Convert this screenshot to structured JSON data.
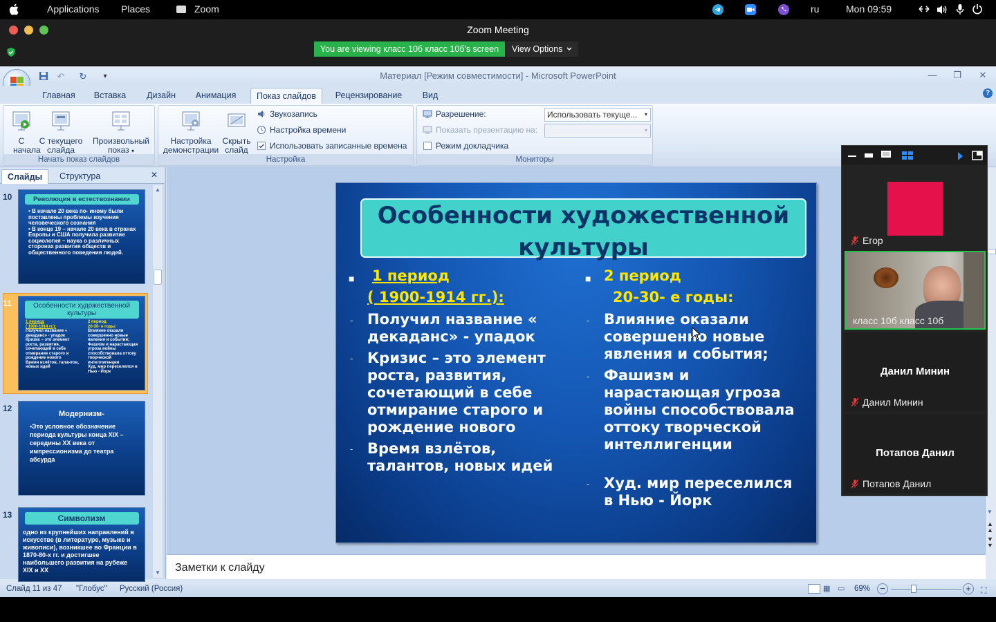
{
  "os_bar": {
    "applications": "Applications",
    "places": "Places",
    "zoom_app": "Zoom",
    "lang": "ru",
    "clock": "Mon 09:59"
  },
  "zoom": {
    "window_title": "Zoom Meeting",
    "viewing_banner": "You are viewing класс 10б класс 10б's screen",
    "view_options": "View Options"
  },
  "ppt": {
    "window_title": "Материал [Режим совместимости] - Microsoft PowerPoint",
    "tabs": [
      "Главная",
      "Вставка",
      "Дизайн",
      "Анимация",
      "Показ слайдов",
      "Рецензирование",
      "Вид"
    ],
    "ribbon": {
      "from_start": "С начала",
      "from_current_l1": "С текущего",
      "from_current_l2": "слайда",
      "custom_l1": "Произвольный",
      "custom_l2": "показ",
      "group1_label": "Начать показ слайдов",
      "setup_l1": "Настройка",
      "setup_l2": "демонстрации",
      "hide_l1": "Скрыть",
      "hide_l2": "слайд",
      "record": "Звукозапись",
      "rehearse": "Настройка времени",
      "use_timings": "Использовать записанные времена",
      "group2_label": "Настройка",
      "resolution_label": "Разрешение:",
      "resolution_value": "Использовать текуще...",
      "show_on_label": "Показать презентацию на:",
      "presenter_view": "Режим докладчика",
      "group3_label": "Мониторы"
    },
    "panel": {
      "tab_slides": "Слайды",
      "tab_outline": "Структура",
      "thumbs": [
        {
          "num": "10",
          "title": "Революция в естествознании",
          "text": "• В начале 20 века по- иному были поставлены проблемы изучения человеческого сознания\n• В конце 19 – начале 20 века в странах Европы и США получила развитие социология – наука о различных сторонах развития обществ и общественного поведения людей."
        },
        {
          "num": "11",
          "title": "Особенности художественной культуры",
          "text": ""
        },
        {
          "num": "12",
          "title": "Модернизм-",
          "text": "•Это условное обозначение периода культуры конца XIX – середины XX века от импрессионизма до театра абсурда"
        },
        {
          "num": "13",
          "title": "Символизм",
          "text": "одно из крупнейших направлений в искусстве (в литературе, музыке и живописи), возникшее во Франции в 1870-80-х гг. и достигшее наибольшего развития на рубеже XIX и XX"
        }
      ]
    },
    "slide": {
      "title": "Особенности художественной культуры",
      "left": {
        "heading1": "1 период",
        "heading2": "( 1900-1914 гг.):",
        "items": [
          "Получил название « декаданс» - упадок",
          "Кризис – это элемент роста, развития, сочетающий в себе отмирание старого и рождение нового",
          "Время взлётов, талантов, новых идей"
        ]
      },
      "right": {
        "heading1": "2 период",
        "heading2": "20-30- е годы:",
        "items": [
          "Влияние оказали совершенно новые явления и события;",
          "Фашизм и нарастающая угроза войны способствовала оттоку творческой интеллигенции",
          "Худ. мир переселился в Нью - Йорк"
        ]
      }
    },
    "notes_placeholder": "Заметки к слайду",
    "status": {
      "slide_pos": "Слайд 11 из 47",
      "theme": "\"Глобус\"",
      "language": "Русский (Россия)",
      "zoom": "69%"
    }
  },
  "participants": [
    {
      "name": "Егор",
      "type": "color",
      "color": "#e4114b",
      "muted": true
    },
    {
      "name": "класс 10б класс 10б",
      "type": "video",
      "muted": false
    },
    {
      "name": "Данил Минин",
      "type": "name",
      "muted": true
    },
    {
      "name": "Потапов Данил",
      "type": "name",
      "muted": true
    }
  ]
}
